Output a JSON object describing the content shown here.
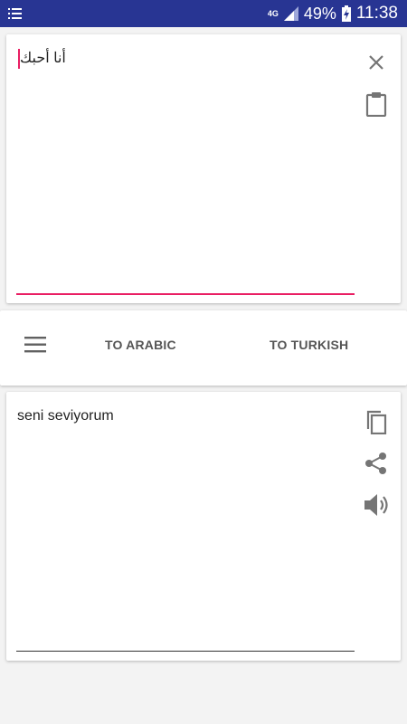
{
  "status_bar": {
    "network": "4G",
    "battery": "49%",
    "time": "11:38"
  },
  "input_card": {
    "text": "أنا أحبك",
    "icons": [
      "close-icon",
      "clipboard-icon"
    ]
  },
  "buttons": {
    "to_arabic": "TO ARABIC",
    "to_turkish": "TO TURKISH"
  },
  "output_card": {
    "text": "seni seviyorum",
    "icons": [
      "copy-icon",
      "share-icon",
      "speaker-icon"
    ]
  },
  "colors": {
    "status_bar": "#283593",
    "accent": "#e91e63"
  }
}
